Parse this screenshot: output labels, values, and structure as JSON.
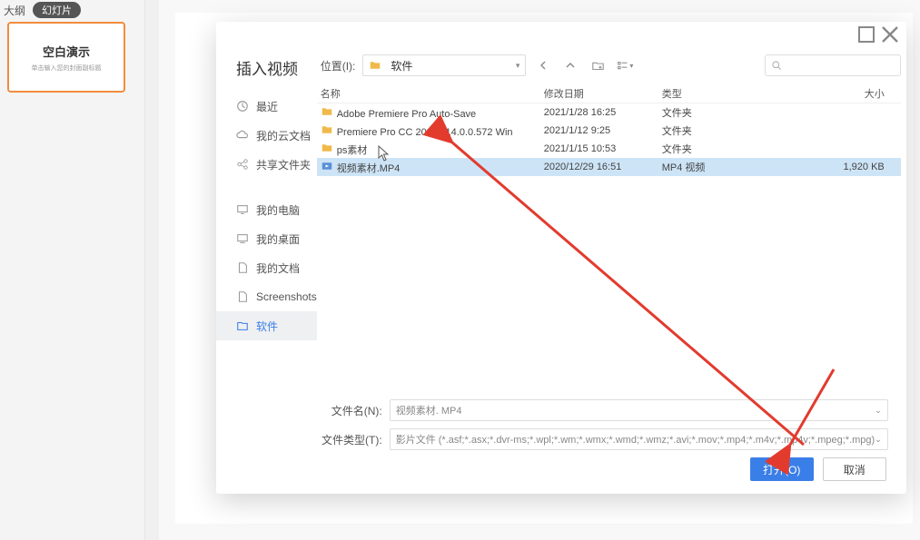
{
  "bg": {
    "tab_outline": "大纲",
    "tab_slides": "幻灯片",
    "thumb_title": "空白演示",
    "thumb_sub": "单击输入您的封面副标题"
  },
  "dialog": {
    "title": "插入视频",
    "path_label": "位置(I):",
    "path_value": "软件",
    "search_placeholder": "",
    "sidebar": [
      {
        "key": "recent",
        "label": "最近",
        "icon": "clock"
      },
      {
        "key": "cloud",
        "label": "我的云文档",
        "icon": "cloud"
      },
      {
        "key": "share",
        "label": "共享文件夹",
        "icon": "share"
      },
      {
        "key": "computer",
        "label": "我的电脑",
        "icon": "monitor"
      },
      {
        "key": "desktop",
        "label": "我的桌面",
        "icon": "desktop"
      },
      {
        "key": "documents",
        "label": "我的文档",
        "icon": "doc"
      },
      {
        "key": "screenshots",
        "label": "Screenshots",
        "icon": "doc"
      },
      {
        "key": "software",
        "label": "软件",
        "icon": "folder",
        "selected": true
      }
    ],
    "headers": {
      "name": "名称",
      "date": "修改日期",
      "type": "类型",
      "size": "大小"
    },
    "rows": [
      {
        "icon": "folder",
        "name": "Adobe Premiere Pro Auto-Save",
        "date": "2021/1/28 16:25",
        "type": "文件夹",
        "size": ""
      },
      {
        "icon": "folder",
        "name": "Premiere Pro CC 2020 v14.0.0.572 Win",
        "date": "2021/1/12 9:25",
        "type": "文件夹",
        "size": ""
      },
      {
        "icon": "folder",
        "name": "ps素材",
        "date": "2021/1/15 10:53",
        "type": "文件夹",
        "size": ""
      },
      {
        "icon": "video",
        "name": "视频素材.MP4",
        "date": "2020/12/29 16:51",
        "type": "MP4 视频",
        "size": "1,920 KB",
        "selected": true
      }
    ],
    "filename_label": "文件名(N):",
    "filename_value": "视频素材. MP4",
    "filetype_label": "文件类型(T):",
    "filetype_value": "影片文件 (*.asf;*.asx;*.dvr-ms;*.wpl;*.wm;*.wmx;*.wmd;*.wmz;*.avi;*.mov;*.mp4;*.m4v;*.mp4v;*.mpeg;*.mpg)",
    "btn_open": "打开(O)",
    "btn_cancel": "取消"
  }
}
